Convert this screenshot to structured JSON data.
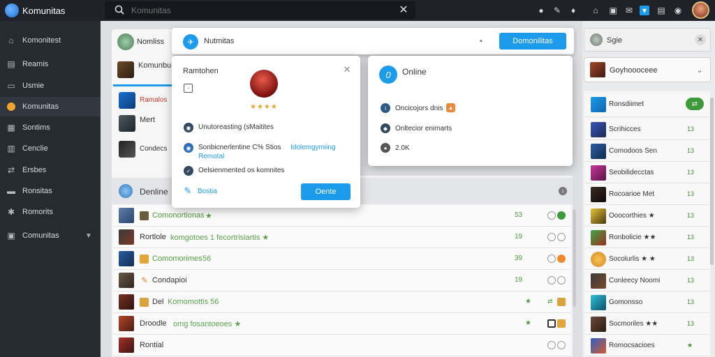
{
  "app": {
    "title": "Komunitas"
  },
  "search": {
    "placeholder": "Komunitas"
  },
  "sidebar": {
    "items": [
      {
        "label": "Komonitest",
        "icon": "home-icon"
      },
      {
        "label": "Reamis",
        "icon": "document-icon"
      },
      {
        "label": "Usmie",
        "icon": "inbox-icon"
      },
      {
        "label": "Komunitas",
        "icon": "community-dot-icon",
        "active": true
      },
      {
        "label": "Sontims",
        "icon": "grid-icon"
      },
      {
        "label": "Cenclie",
        "icon": "chart-icon"
      },
      {
        "label": "Ersbes",
        "icon": "share-icon"
      },
      {
        "label": "Ronsitas",
        "icon": "folder-icon"
      },
      {
        "label": "Romorits",
        "icon": "gear-icon"
      },
      {
        "label": "Comunitas",
        "icon": "layers-icon"
      }
    ]
  },
  "left_cards": [
    {
      "title": "Nomliss"
    },
    {
      "title": "Komunbu"
    },
    {
      "title": "Ramalos"
    },
    {
      "title": "Mert"
    },
    {
      "title": "Condecs"
    }
  ],
  "header_modal": {
    "title": "Nutmitas",
    "button": "Domonilitas"
  },
  "modal_a": {
    "title": "Ramtohen",
    "stars": "★★★★",
    "rows": [
      {
        "text": "Unutoreasting (sMaitites"
      },
      {
        "text": "Sonbicnerlentine C% Stios",
        "link": "Idolemgymiing",
        "sub": "Remotal"
      },
      {
        "text": "Oelsienmented os komnites"
      }
    ],
    "link": "Bostia",
    "button": "Oente"
  },
  "modal_b": {
    "title": "Online",
    "rows": [
      {
        "text": "Oncicojors dnis"
      },
      {
        "text": "Onltecior enimarts"
      },
      {
        "text": "2.0K"
      }
    ]
  },
  "list": {
    "header": "Denline",
    "rows": [
      {
        "name": "Comonortionas",
        "meta": "★",
        "count": "53"
      },
      {
        "name": "Rortlole",
        "meta": "komgotoes 1 fecortrisiartis ★",
        "count": "19"
      },
      {
        "name": "Comomorimes",
        "meta": "56",
        "count": "39"
      },
      {
        "name": "Condapioi",
        "meta": "",
        "count": "19"
      },
      {
        "name": "Del",
        "meta": "Komomottis 56",
        "count": "★"
      },
      {
        "name": "Droodle",
        "meta": "omg fosantoeoes ★",
        "count": "★"
      },
      {
        "name": "Rontial",
        "meta": "",
        "count": ""
      }
    ]
  },
  "right": {
    "top_label": "Sgie",
    "select_label": "Goyhoooceee",
    "list_header": "Ronsdiimet",
    "rows": [
      {
        "label": "Scrihicces",
        "count": "13"
      },
      {
        "label": "Comodoos Sen",
        "count": "13"
      },
      {
        "label": "Seobilidecctas",
        "count": "13"
      },
      {
        "label": "Rocoarioe Met",
        "count": "13"
      },
      {
        "label": "Ooocorthies ★",
        "count": "13"
      },
      {
        "label": "Ronbolicie ★★",
        "count": "13"
      },
      {
        "label": "Socolurlis ★ ★",
        "count": "13"
      },
      {
        "label": "Conleecy Noomi",
        "count": "13"
      },
      {
        "label": "Gomonsso",
        "count": "13"
      },
      {
        "label": "Socmoriles ★★",
        "count": "13"
      },
      {
        "label": "Romocsacioes",
        "count": "★"
      }
    ]
  }
}
